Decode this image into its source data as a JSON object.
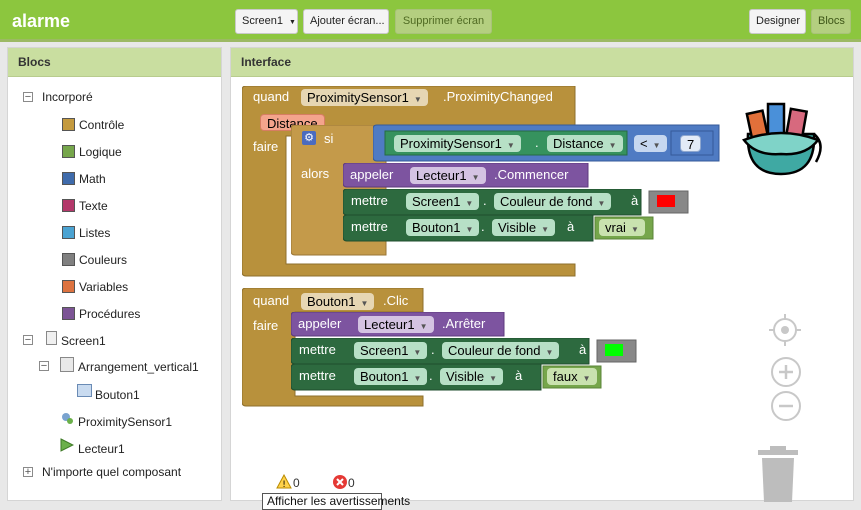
{
  "app": {
    "title": "alarme"
  },
  "toolbar": {
    "screen_select": "Screen1",
    "add_screen": "Ajouter écran...",
    "remove_screen": "Supprimer écran",
    "designer": "Designer",
    "blocks": "Blocs"
  },
  "blocks_panel": {
    "title": "Blocs",
    "builtin_label": "Incorporé",
    "builtin_items": [
      {
        "label": "Contrôle",
        "color": "#c49a3e"
      },
      {
        "label": "Logique",
        "color": "#76a64b"
      },
      {
        "label": "Math",
        "color": "#3f6bab"
      },
      {
        "label": "Texte",
        "color": "#b3386a"
      },
      {
        "label": "Listes",
        "color": "#4ba3d2"
      },
      {
        "label": "Couleurs",
        "color": "#808080"
      },
      {
        "label": "Variables",
        "color": "#dd7340"
      },
      {
        "label": "Procédures",
        "color": "#7c5495"
      }
    ],
    "components": {
      "screen": "Screen1",
      "arrangement": "Arrangement_vertical1",
      "button": "Bouton1",
      "sensor": "ProximitySensor1",
      "player": "Lecteur1"
    },
    "any_component": "N'importe quel composant"
  },
  "interface_panel": {
    "title": "Interface",
    "event1": {
      "when": "quand",
      "component": "ProximitySensor1",
      "event": ".ProximityChanged",
      "param": "Distance",
      "do": "faire",
      "if_label": "si",
      "then_label": "alors",
      "cond_component": "ProximitySensor1",
      "cond_property": "Distance",
      "cond_operator": "<",
      "cond_value": "7",
      "call_label": "appeler",
      "call_component": "Lecteur1",
      "call_method": ".Commencer",
      "set1_label": "mettre",
      "set1_component": "Screen1",
      "set1_property": "Couleur de fond",
      "to_label": "à",
      "set1_color": "#ff0000",
      "set2_label": "mettre",
      "set2_component": "Bouton1",
      "set2_property": "Visible",
      "set2_value": "vrai",
      "dot": "."
    },
    "event2": {
      "when": "quand",
      "component": "Bouton1",
      "event": ".Clic",
      "do": "faire",
      "call_label": "appeler",
      "call_component": "Lecteur1",
      "call_method": ".Arrêter",
      "set1_label": "mettre",
      "set1_component": "Screen1",
      "set1_property": "Couleur de fond",
      "to_label": "à",
      "set1_color": "#00ff00",
      "set2_label": "mettre",
      "set2_component": "Bouton1",
      "set2_property": "Visible",
      "set2_value": "faux",
      "dot": "."
    },
    "warnings_count": "0",
    "errors_count": "0",
    "show_warnings": "Afficher les avertissements"
  }
}
